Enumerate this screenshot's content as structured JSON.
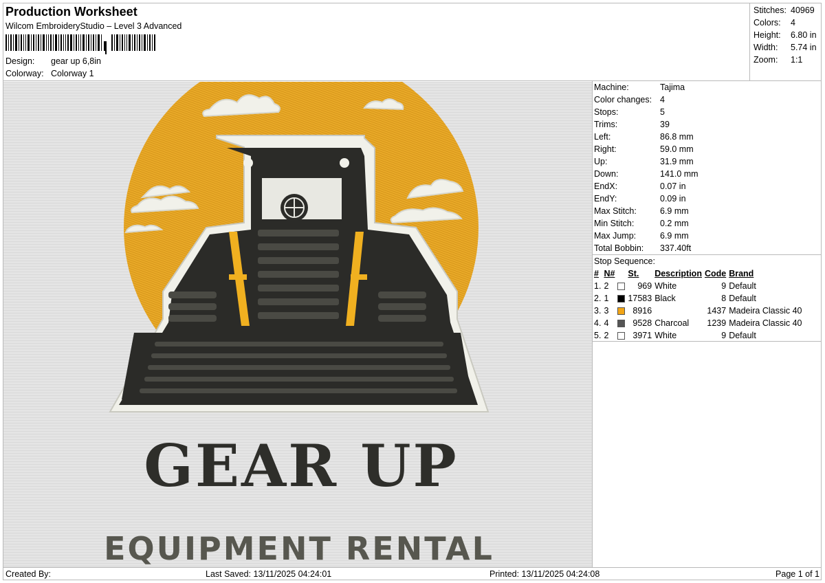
{
  "header": {
    "title": "Production Worksheet",
    "software": "Wilcom EmbroideryStudio – Level 3 Advanced",
    "design_label": "Design:",
    "design_value": "gear up 6,8in",
    "colorway_label": "Colorway:",
    "colorway_value": "Colorway 1"
  },
  "summary": [
    {
      "label": "Stitches:",
      "value": "40969"
    },
    {
      "label": "Colors:",
      "value": "4"
    },
    {
      "label": "Height:",
      "value": "6.80 in"
    },
    {
      "label": "Width:",
      "value": "5.74 in"
    },
    {
      "label": "Zoom:",
      "value": "1:1"
    }
  ],
  "machine_info": [
    {
      "label": "Machine:",
      "value": "Tajima"
    },
    {
      "label": "Color changes:",
      "value": "4"
    },
    {
      "label": "Stops:",
      "value": "5"
    },
    {
      "label": "Trims:",
      "value": "39"
    },
    {
      "label": "Left:",
      "value": "86.8 mm"
    },
    {
      "label": "Right:",
      "value": "59.0 mm"
    },
    {
      "label": "Up:",
      "value": "31.9 mm"
    },
    {
      "label": "Down:",
      "value": "141.0 mm"
    },
    {
      "label": "EndX:",
      "value": "0.07 in"
    },
    {
      "label": "EndY:",
      "value": "0.09 in"
    },
    {
      "label": "Max Stitch:",
      "value": "6.9 mm"
    },
    {
      "label": "Min Stitch:",
      "value": "0.2 mm"
    },
    {
      "label": "Max Jump:",
      "value": "6.9 mm"
    },
    {
      "label": "Total Bobbin:",
      "value": "337.40ft"
    }
  ],
  "stop_sequence": {
    "title": "Stop Sequence:",
    "columns": [
      "#",
      "N#",
      "St.",
      "Description",
      "Code",
      "Brand"
    ],
    "rows": [
      {
        "num": "1.",
        "n": "2",
        "color": "#ffffff",
        "st": "969",
        "desc": "White",
        "code": "9",
        "brand": "Default"
      },
      {
        "num": "2.",
        "n": "1",
        "color": "#000000",
        "st": "17583",
        "desc": "Black",
        "code": "8",
        "brand": "Default"
      },
      {
        "num": "3.",
        "n": "3",
        "color": "#f2a516",
        "st": "8916",
        "desc": "",
        "code": "1437",
        "brand": "Madeira Classic 40"
      },
      {
        "num": "4.",
        "n": "4",
        "color": "#555555",
        "st": "9528",
        "desc": "Charcoal",
        "code": "1239",
        "brand": "Madeira Classic 40"
      },
      {
        "num": "5.",
        "n": "2",
        "color": "#ffffff",
        "st": "3971",
        "desc": "White",
        "code": "9",
        "brand": "Default"
      }
    ]
  },
  "design_text": {
    "line1": "GEAR UP",
    "line2": "EQUIPMENT RENTAL"
  },
  "colors": {
    "sun": "#e9aa28",
    "machine": "#2b2b28",
    "cloud": "#f1f1ea",
    "text_dark": "#2e2e2a",
    "text_grey": "#57574f",
    "background": "#e4e4e4"
  },
  "footer": {
    "created_by": "Created By:",
    "last_saved": "Last Saved: 13/11/2025 04:24:01",
    "printed": "Printed: 13/11/2025 04:24:08",
    "page": "Page 1 of 1"
  }
}
